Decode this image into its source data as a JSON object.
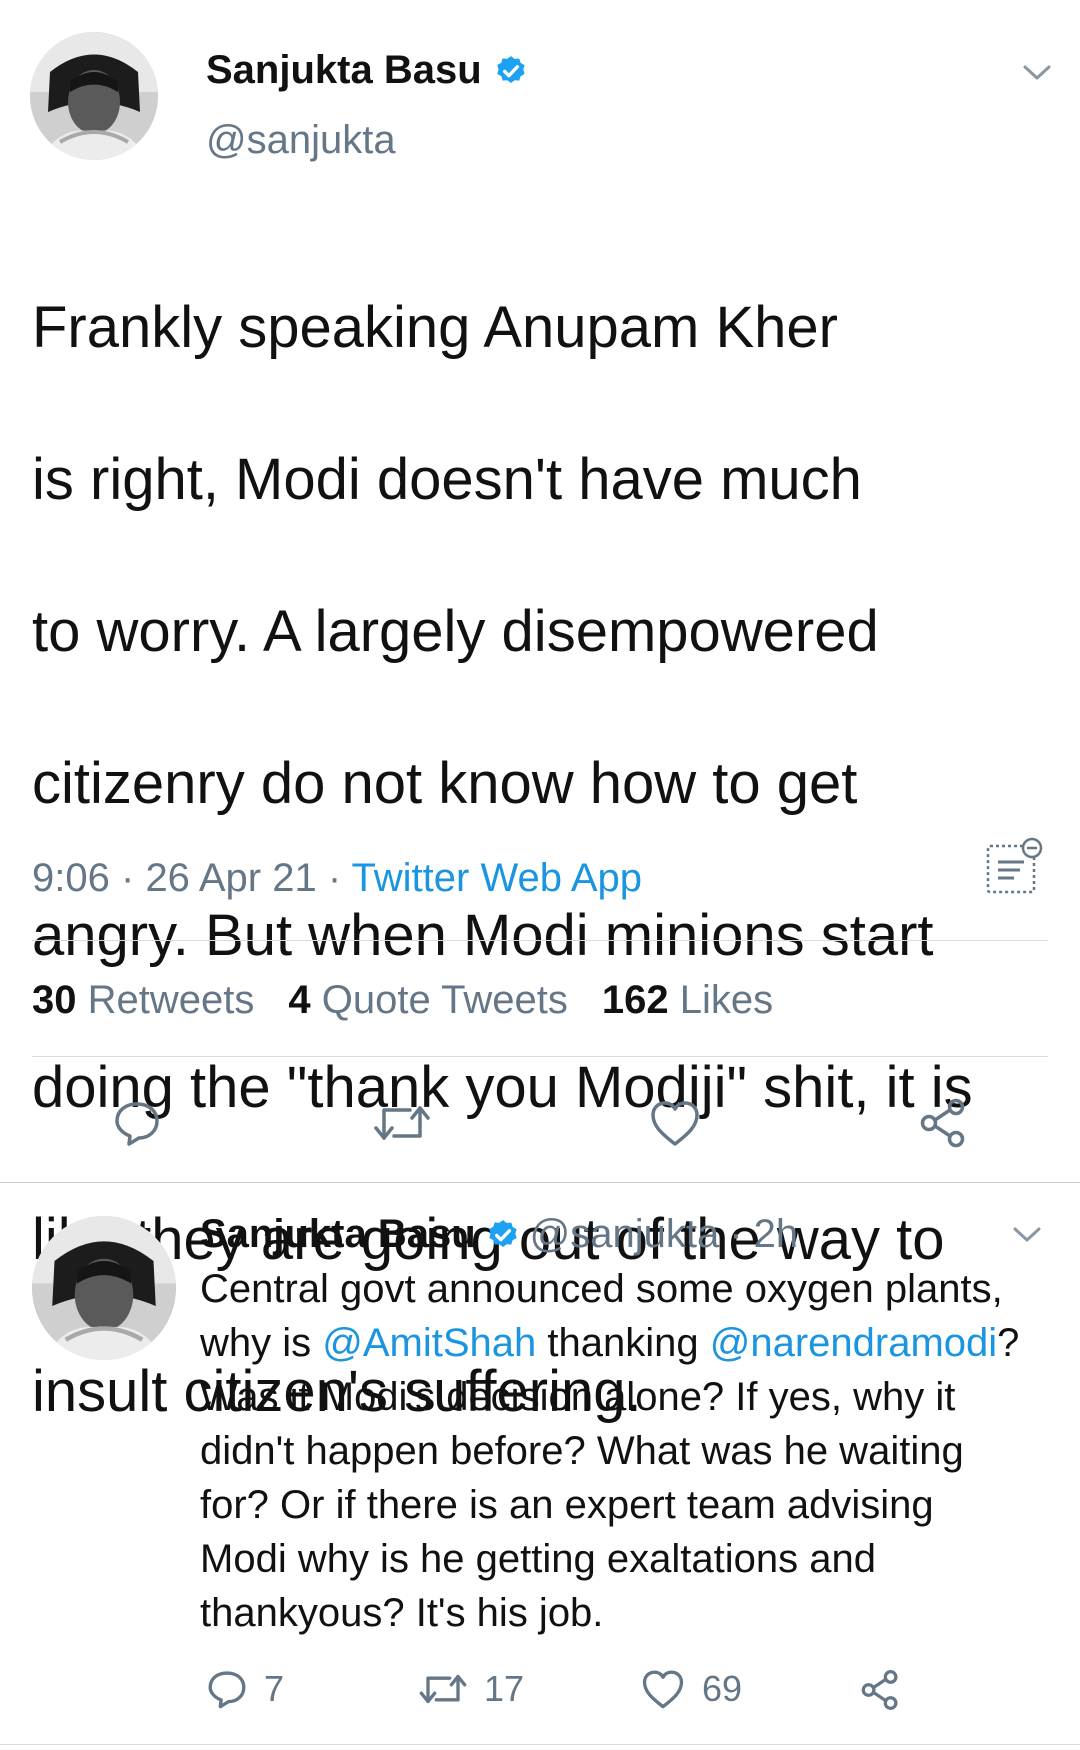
{
  "main_tweet": {
    "author_name": "Sanjukta Basu",
    "handle": "@sanjukta",
    "text_lines": [
      "Frankly speaking Anupam Kher",
      "is right, Modi doesn't have much",
      "to worry. A largely disempowered",
      "citizenry do not know how to get",
      "angry. But when Modi minions start",
      "doing the \"thank you Modiji\" shit, it is",
      "like they are going out of the way to",
      "insult citizen's suffering."
    ],
    "time": "9:06",
    "date": "26 Apr 21",
    "separator": "·",
    "source": "Twitter Web App",
    "stats": {
      "retweets_count": "30",
      "retweets_label": "Retweets",
      "quotes_count": "4",
      "quotes_label": "Quote Tweets",
      "likes_count": "162",
      "likes_label": "Likes"
    }
  },
  "reply_tweet": {
    "author_name": "Sanjukta Basu",
    "handle": "@sanjukta",
    "age": "· 2h",
    "line1": "Central govt announced some oxygen plants,",
    "line2_prefix": "why is ",
    "mention1": "@AmitShah",
    "line2_middle": " thanking ",
    "mention2": "@narendramodi",
    "line2_suffix": "?",
    "rest_lines": [
      "Was it Modi's decision alone? If yes, why it",
      "didn't happen before? What was he waiting",
      "for? Or if there is an expert team advising",
      "Modi why is he getting exaltations and",
      "thankyous? It's his job."
    ],
    "reply_count": "7",
    "retweet_count": "17",
    "like_count": "69"
  },
  "icons": {
    "verified": "verified-badge-icon",
    "caret": "chevron-down-icon",
    "analytics": "analytics-icon",
    "reply": "reply-icon",
    "retweet": "retweet-icon",
    "like": "heart-icon",
    "share": "share-icon"
  },
  "colors": {
    "link": "#1b95e0",
    "muted": "#657786",
    "text": "#111111",
    "verified": "#1da1f2"
  }
}
